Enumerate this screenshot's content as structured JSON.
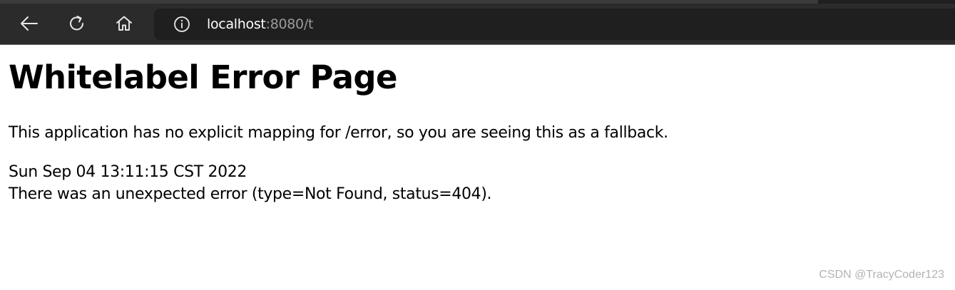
{
  "browser": {
    "back_icon": "arrow-left-icon",
    "reload_icon": "refresh-icon",
    "home_icon": "home-icon",
    "site_info_icon": "info-circle-icon",
    "url_host": "localhost",
    "url_rest": ":8080/t"
  },
  "page": {
    "title": "Whitelabel Error Page",
    "message": "This application has no explicit mapping for /error, so you are seeing this as a fallback.",
    "timestamp": "Sun Sep 04 13:11:15 CST 2022",
    "error_detail": "There was an unexpected error (type=Not Found, status=404)."
  },
  "watermark": "CSDN @TracyCoder123",
  "colors": {
    "toolbar_bg": "#2b2b2b",
    "address_bg": "#1f1f1f",
    "url_host": "#ffffff",
    "url_rest": "#9a9a9a",
    "page_bg": "#ffffff",
    "text": "#000000",
    "watermark": "#b3b3b3"
  }
}
